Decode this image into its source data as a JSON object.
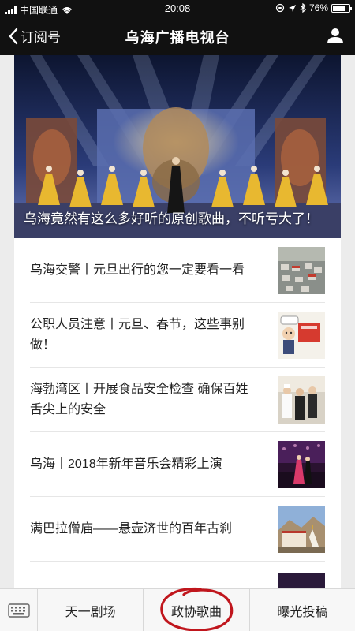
{
  "status": {
    "carrier": "中国联通",
    "time": "20:08",
    "battery": "76%",
    "battery_level": 0.76
  },
  "nav": {
    "back_label": "订阅号",
    "title": "乌海广播电视台",
    "profile_icon": "person-icon"
  },
  "hero": {
    "caption": "乌海竟然有这么多好听的原创歌曲，不听亏大了！"
  },
  "articles": [
    {
      "title": "乌海交警丨元旦出行的您一定要看一看",
      "thumb": "traffic-photo"
    },
    {
      "title": "公职人员注意丨元旦、春节，这些事别做！",
      "thumb": "cartoon-illustration"
    },
    {
      "title": "海勃湾区丨开展食品安全检查 确保百姓舌尖上的安全",
      "thumb": "inspection-photo"
    },
    {
      "title": "乌海丨2018年新年音乐会精彩上演",
      "thumb": "concert-photo"
    },
    {
      "title": "满巴拉僧庙——悬壶济世的百年古刹",
      "thumb": "temple-photo"
    }
  ],
  "bottom_menu": {
    "keyboard_icon": "keyboard-icon",
    "items": [
      "天一剧场",
      "政协歌曲",
      "曝光投稿"
    ],
    "highlight_color": "#c0161d"
  }
}
